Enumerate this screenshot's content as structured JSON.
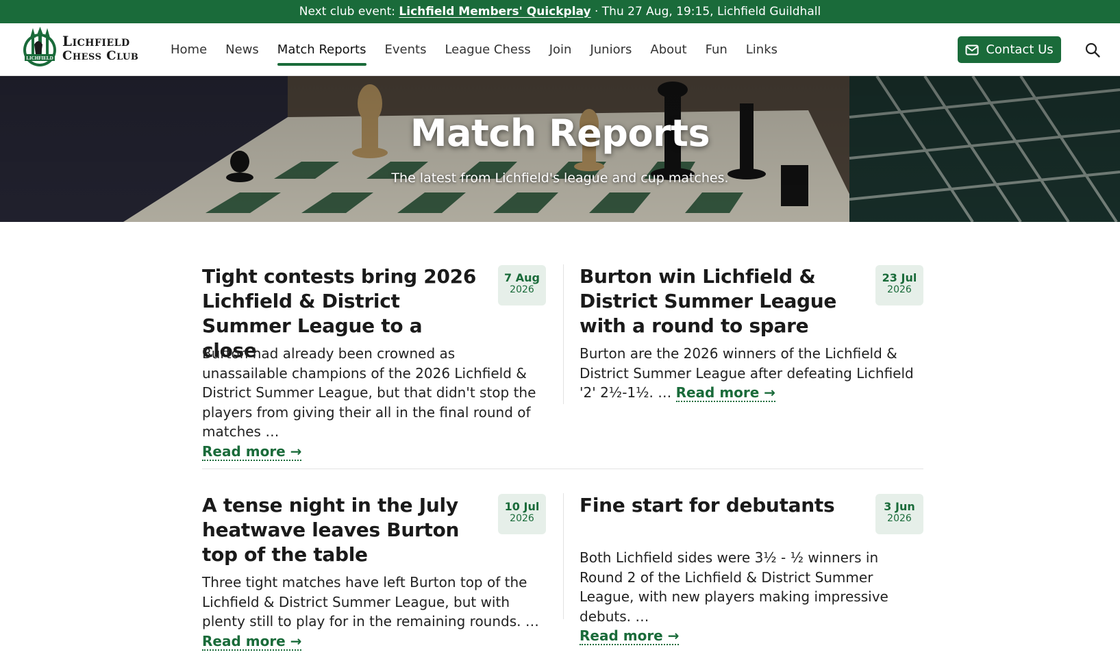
{
  "announcement": {
    "prefix": "Next club event: ",
    "link": "Lichfield Members' Quickplay",
    "suffix": " · Thu 27 Aug, 19:15, Lichfield Guildhall"
  },
  "brand": {
    "name_line1": "Lichfield",
    "name_line2": "Chess Club",
    "crest_text": "LICHFIELD",
    "accent_color": "#1a6b3a"
  },
  "nav": {
    "items": [
      {
        "label": "Home"
      },
      {
        "label": "News"
      },
      {
        "label": "Match Reports",
        "active": true
      },
      {
        "label": "Events"
      },
      {
        "label": "League Chess"
      },
      {
        "label": "Join"
      },
      {
        "label": "Juniors"
      },
      {
        "label": "About"
      },
      {
        "label": "Fun"
      },
      {
        "label": "Links"
      }
    ],
    "contact_label": "Contact Us",
    "contact_icon": "envelope-icon",
    "search_icon": "search-icon"
  },
  "hero": {
    "title": "Match Reports",
    "subtitle": "The latest from Lichfield's league and cup matches."
  },
  "articles": [
    {
      "title": "Tight contests bring 2026 Lichfield & District Summer League to a close",
      "date_day": "7 Aug",
      "date_year": "2026",
      "excerpt": "Burton had already been crowned as unassailable champions of the 2026 Lichfield & District Summer League, but that didn't stop the players from giving their all in the final round of matches …",
      "read_more": "Read more →"
    },
    {
      "title": "Burton win Lichfield & District Summer League with a round to spare",
      "date_day": "23 Jul",
      "date_year": "2026",
      "excerpt": "Burton are the 2026 winners of the Lichfield & District Summer League after defeating Lichfield '2' 2½-1½. …",
      "read_more": "Read more →"
    },
    {
      "title": "A tense night in the July heatwave leaves Burton top of the table",
      "date_day": "10 Jul",
      "date_year": "2026",
      "excerpt": "Three tight matches have left Burton top of the Lichfield & District Summer League, but with plenty still to play for in the remaining rounds. …",
      "read_more": "Read more →"
    },
    {
      "title": "Fine start for debutants",
      "date_day": "3 Jun",
      "date_year": "2026",
      "excerpt": "Both Lichfield sides were 3½ - ½ winners in Round 2 of the Lichfield & District Summer League, with new players making impressive debuts. …",
      "read_more": "Read more →"
    }
  ]
}
